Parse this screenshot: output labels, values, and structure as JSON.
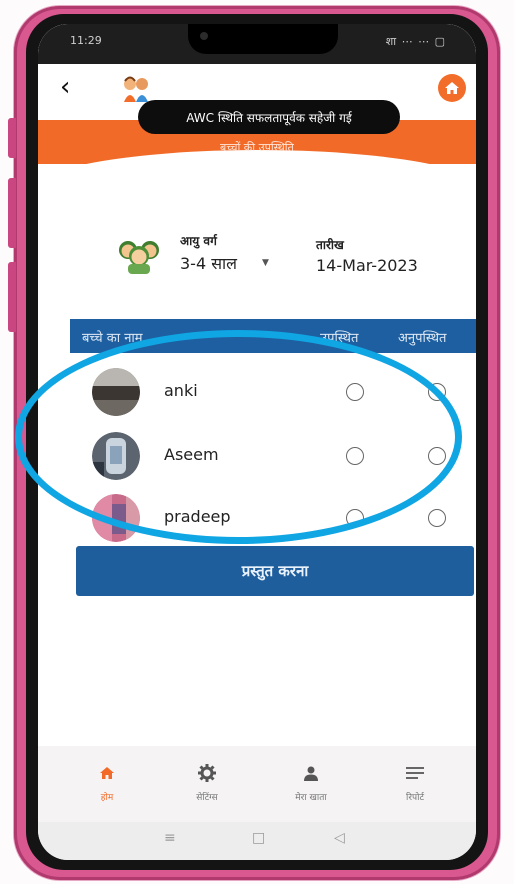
{
  "status_bar": {
    "time": "11:29",
    "indicators": "शा ⋯ ⋯ ▢"
  },
  "header": {
    "toast": "AWC स्थिति सफलतापूर्वक सहेजी गई",
    "title": "बच्चों की उपस्थिति"
  },
  "filters": {
    "age_label": "आयु वर्ग",
    "age_value": "3-4 साल",
    "date_label": "तारीख",
    "date_value": "14-Mar-2023"
  },
  "table": {
    "headers": {
      "name": "बच्चे का नाम",
      "present": "उपस्थित",
      "absent": "अनुपस्थित"
    },
    "rows": [
      {
        "name": "anki"
      },
      {
        "name": "Aseem"
      },
      {
        "name": "pradeep"
      }
    ]
  },
  "submit_label": "प्रस्तुत करना",
  "bottom_nav": [
    {
      "label": "होम",
      "icon": "home-icon",
      "active": true
    },
    {
      "label": "सेटिंग्स",
      "icon": "gear-icon",
      "active": false
    },
    {
      "label": "मेरा खाता",
      "icon": "user-icon",
      "active": false
    },
    {
      "label": "रिपोर्ट",
      "icon": "list-icon",
      "active": false
    }
  ],
  "colors": {
    "accent_orange": "#f26a28",
    "primary_blue": "#1d5fa0",
    "highlight_ring": "#10a5e3",
    "phone_case": "#d9588f"
  }
}
